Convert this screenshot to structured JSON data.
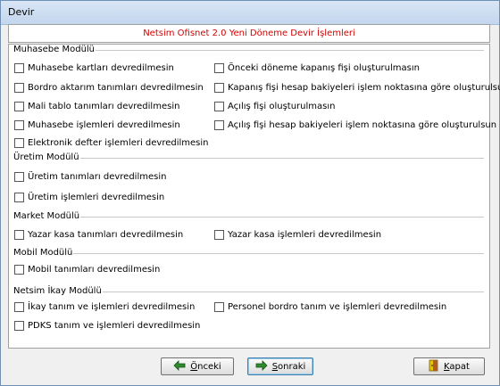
{
  "window": {
    "title": "Devir"
  },
  "header": {
    "text": "Netsim Ofisnet 2.0 Yeni Döneme Devir İşlemleri"
  },
  "groups": {
    "muhasebe": {
      "title": "Muhasebe Modülü",
      "left": [
        "Muhasebe kartları devredilmesin",
        "Bordro aktarım tanımları devredilmesin",
        "Mali tablo tanımları devredilmesin",
        "Muhasebe işlemleri devredilmesin",
        "Elektronik defter işlemleri devredilmesin"
      ],
      "right": [
        "Önceki döneme kapanış fişi oluşturulmasın",
        "Kapanış fişi hesap bakiyeleri işlem noktasına göre oluşturulsun",
        "Açılış fişi oluşturulmasın",
        "Açılış fişi hesap bakiyeleri işlem noktasına göre oluşturulsun"
      ]
    },
    "uretim": {
      "title": "Üretim Modülü",
      "items": [
        "Üretim tanımları devredilmesin",
        "Üretim işlemleri devredilmesin"
      ]
    },
    "market": {
      "title": "Market Modülü",
      "items": [
        "Yazar kasa tanımları devredilmesin",
        "Yazar kasa işlemleri devredilmesin"
      ]
    },
    "mobil": {
      "title": "Mobil Modülü",
      "items": [
        "Mobil tanımları devredilmesin"
      ]
    },
    "ikay": {
      "title": "Netsim İkay Modülü",
      "items": [
        "İkay tanım ve işlemleri devredilmesin",
        "Personel bordro tanım ve işlemleri devredilmesin",
        "PDKS tanım ve işlemleri devredilmesin"
      ]
    }
  },
  "buttons": {
    "prev": "Önceki",
    "next": "Sonraki",
    "close": "Kapat"
  },
  "icons": {
    "prev": "arrow-left-icon",
    "next": "arrow-right-icon",
    "close": "door-exit-icon"
  },
  "checked": false
}
